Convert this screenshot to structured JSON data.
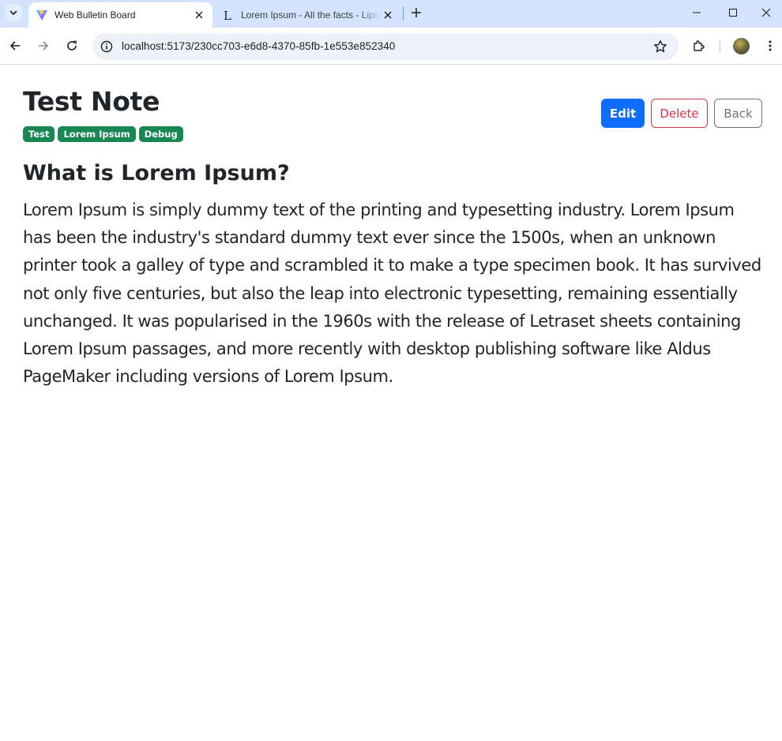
{
  "browser": {
    "tabs": [
      {
        "title": "Web Bulletin Board",
        "active": true,
        "favicon": "vite-logo-icon"
      },
      {
        "title": "Lorem Ipsum - All the facts - Lipsum generator",
        "active": false,
        "favicon": "lipsum-l-icon"
      }
    ],
    "url": "localhost:5173/230cc703-e6d8-4370-85fb-1e553e852340"
  },
  "note": {
    "title": "Test Note",
    "tags": [
      "Test",
      "Lorem Ipsum",
      "Debug"
    ],
    "actions": {
      "edit": "Edit",
      "delete": "Delete",
      "back": "Back"
    },
    "heading": "What is Lorem Ipsum?",
    "body": "Lorem Ipsum is simply dummy text of the printing and typesetting industry. Lorem Ipsum has been the industry's standard dummy text ever since the 1500s, when an unknown printer took a galley of type and scrambled it to make a type specimen book. It has survived not only five centuries, but also the leap into electronic typesetting, remaining essentially unchanged. It was popularised in the 1960s with the release of Letraset sheets containing Lorem Ipsum passages, and more recently with desktop publishing software like Aldus PageMaker including versions of Lorem Ipsum."
  },
  "colors": {
    "tag": "#198754",
    "primary": "#0d6efd",
    "danger": "#dc3545",
    "secondary": "#6c757d",
    "tabstrip": "#d3e3fd"
  }
}
